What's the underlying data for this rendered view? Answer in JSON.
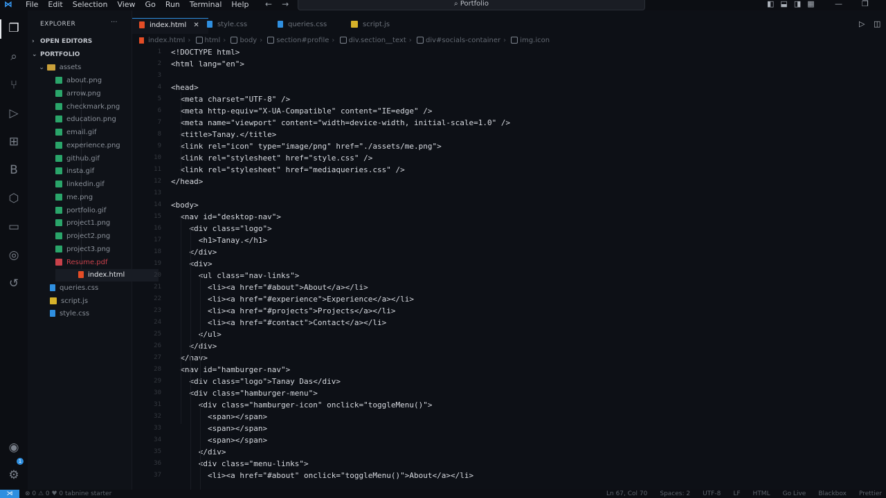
{
  "titlebar": {
    "menu": [
      "File",
      "Edit",
      "Selection",
      "View",
      "Go",
      "Run",
      "Terminal",
      "Help"
    ],
    "search_text": "Portfolio"
  },
  "sidebar": {
    "header": "EXPLORER",
    "open_editors_label": "OPEN EDITORS",
    "project_label": "PORTFOLIO",
    "folder": "assets",
    "asset_files": [
      "about.png",
      "arrow.png",
      "checkmark.png",
      "education.png",
      "email.gif",
      "experience.png",
      "github.gif",
      "insta.gif",
      "linkedin.gif",
      "me.png",
      "portfolio.gif",
      "project1.png",
      "project2.png",
      "project3.png",
      "Resume.pdf"
    ],
    "root_files": [
      "index.html",
      "queries.css",
      "script.js",
      "style.css"
    ]
  },
  "tabs": [
    {
      "label": "index.html",
      "active": true,
      "kind": "html"
    },
    {
      "label": "style.css",
      "active": false,
      "kind": "css"
    },
    {
      "label": "queries.css",
      "active": false,
      "kind": "css"
    },
    {
      "label": "script.js",
      "active": false,
      "kind": "js"
    }
  ],
  "breadcrumb": [
    "index.html",
    "html",
    "body",
    "section#profile",
    "div.section__text",
    "div#socials-container",
    "img.icon"
  ],
  "code_lines": [
    "<!DOCTYPE html>",
    "<html lang=\"en\">",
    "",
    "<head>",
    "  <meta charset=\"UTF-8\" />",
    "  <meta http-equiv=\"X-UA-Compatible\" content=\"IE=edge\" />",
    "  <meta name=\"viewport\" content=\"width=device-width, initial-scale=1.0\" />",
    "  <title>Tanay.</title>",
    "  <link rel=\"icon\" type=\"image/png\" href=\"./assets/me.png\">",
    "  <link rel=\"stylesheet\" href=\"style.css\" />",
    "  <link rel=\"stylesheet\" href=\"mediaqueries.css\" />",
    "</head>",
    "",
    "<body>",
    "  <nav id=\"desktop-nav\">",
    "    <div class=\"logo\">",
    "      <h1>Tanay.</h1>",
    "    </div>",
    "    <div>",
    "      <ul class=\"nav-links\">",
    "        <li><a href=\"#about\">About</a></li>",
    "        <li><a href=\"#experience\">Experience</a></li>",
    "        <li><a href=\"#projects\">Projects</a></li>",
    "        <li><a href=\"#contact\">Contact</a></li>",
    "      </ul>",
    "    </div>",
    "  </nav>",
    "  <nav id=\"hamburger-nav\">",
    "    <div class=\"logo\">Tanay Das</div>",
    "    <div class=\"hamburger-menu\">",
    "      <div class=\"hamburger-icon\" onclick=\"toggleMenu()\">",
    "        <span></span>",
    "        <span></span>",
    "        <span></span>",
    "      </div>",
    "      <div class=\"menu-links\">",
    "        <li><a href=\"#about\" onclick=\"toggleMenu()\">About</a></li>"
  ],
  "statusbar": {
    "left": "⊗ 0 ⚠ 0   ♥ 0   tabnine starter",
    "right": [
      "Ln 67, Col 70",
      "Spaces: 2",
      "UTF-8",
      "LF",
      "HTML",
      "Go Live",
      "Blackbox",
      "Prettier"
    ]
  },
  "colors": {
    "accent": "#2f8fe0",
    "background": "#0d1016"
  }
}
